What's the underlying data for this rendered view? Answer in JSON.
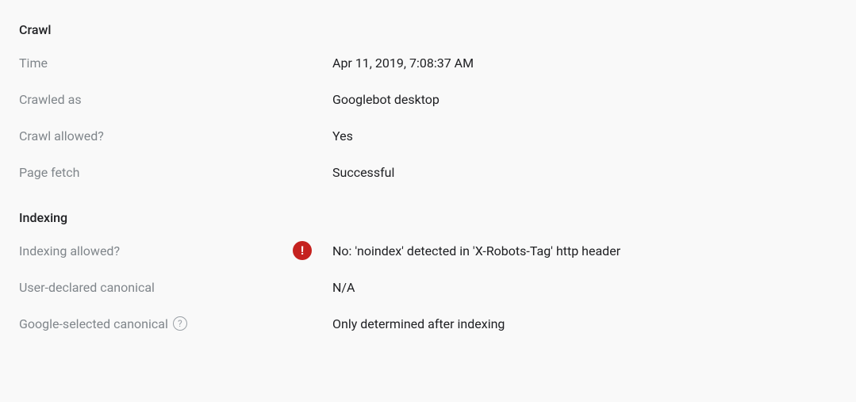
{
  "sections": {
    "crawl": {
      "title": "Crawl",
      "rows": {
        "time": {
          "label": "Time",
          "value": "Apr 11, 2019, 7:08:37 AM"
        },
        "crawled_as": {
          "label": "Crawled as",
          "value": "Googlebot desktop"
        },
        "crawl_allowed": {
          "label": "Crawl allowed?",
          "value": "Yes"
        },
        "page_fetch": {
          "label": "Page fetch",
          "value": "Successful"
        }
      }
    },
    "indexing": {
      "title": "Indexing",
      "rows": {
        "indexing_allowed": {
          "label": "Indexing allowed?",
          "value": "No: 'noindex' detected in 'X-Robots-Tag' http header"
        },
        "user_canonical": {
          "label": "User-declared canonical",
          "value": "N/A"
        },
        "google_canonical": {
          "label": "Google-selected canonical",
          "value": "Only determined after indexing"
        }
      }
    }
  },
  "icons": {
    "error_glyph": "!",
    "help_glyph": "?"
  }
}
